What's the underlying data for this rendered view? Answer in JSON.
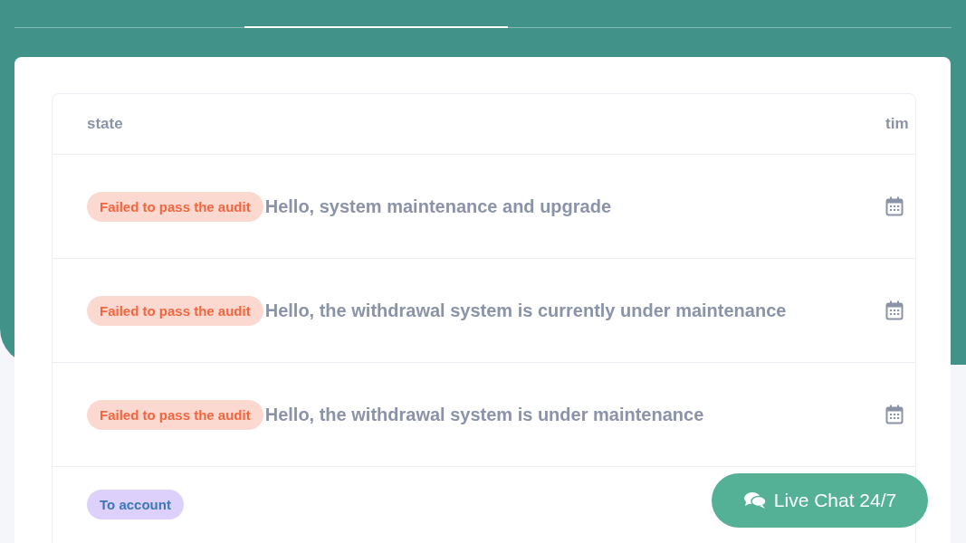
{
  "tabs": [
    {
      "selected": false
    },
    {
      "selected": true
    }
  ],
  "table": {
    "columns": [
      "state",
      "tim"
    ],
    "rows": [
      {
        "status": {
          "kind": "failed",
          "label": "Failed to pass the audit"
        },
        "message": "Hello, system maintenance and upgrade"
      },
      {
        "status": {
          "kind": "failed",
          "label": "Failed to pass the audit"
        },
        "message": "Hello, the withdrawal system is currently under maintenance"
      },
      {
        "status": {
          "kind": "failed",
          "label": "Failed to pass the audit"
        },
        "message": "Hello, the withdrawal system is under maintenance"
      },
      {
        "status": {
          "kind": "to_account",
          "label": "To account"
        },
        "message": ""
      }
    ]
  },
  "live_chat": {
    "label": "Live Chat 24/7"
  }
}
